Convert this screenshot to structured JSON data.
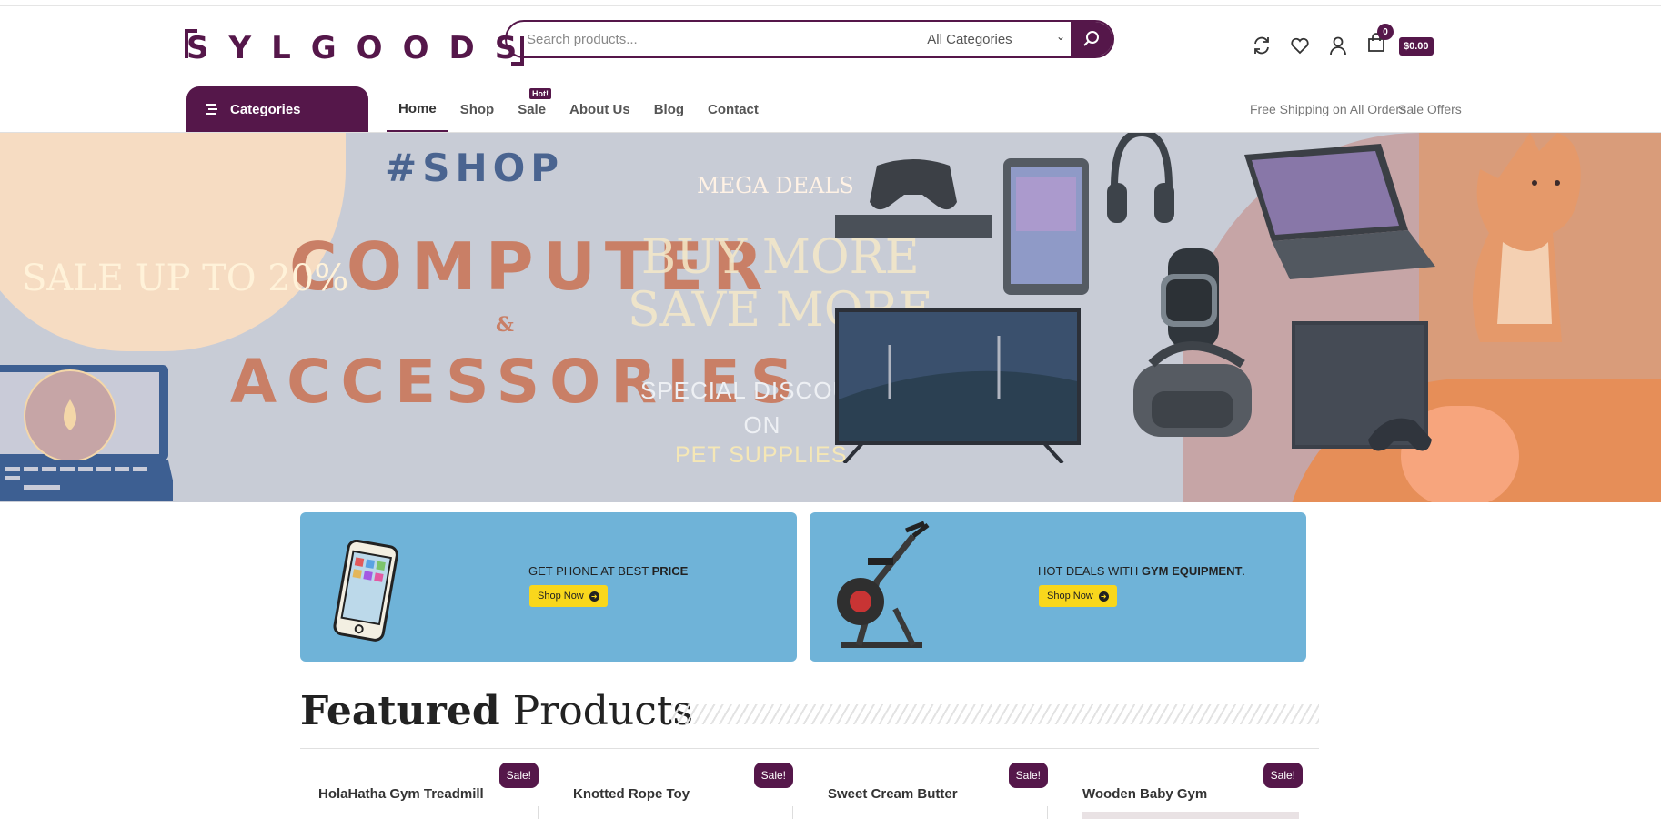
{
  "brand": {
    "logo_text": "SYLGOODS"
  },
  "search": {
    "placeholder": "Search products...",
    "category": "All Categories"
  },
  "header": {
    "cart_count": "0",
    "cart_total": "$0.00"
  },
  "nav": {
    "categories_label": "Categories",
    "items": [
      "Home",
      "Shop",
      "Sale",
      "About Us",
      "Blog",
      "Contact"
    ],
    "hot_badge": "Hot!",
    "right_links": [
      "Free Shipping on All Orders",
      "Sale Offers"
    ]
  },
  "hero": {
    "shop_tag": "#SHOP",
    "title_line1": "COMPUTER",
    "ampersand": "&",
    "title_line2": "ACCESSORIES",
    "sale_text": "SALE UP TO 20%",
    "mega": "MEGA DEALS",
    "buy_more": "BUY MORE",
    "save_more": "SAVE MORE",
    "special": "SPECIAL DISCOUNT",
    "on": "ON",
    "pet_supplies": "PET SUPPLIES"
  },
  "promos": [
    {
      "text_plain": "GET PHONE AT BEST ",
      "text_bold": "PRICE",
      "text_after": "",
      "button": "Shop Now"
    },
    {
      "text_plain": "HOT DEALS WITH ",
      "text_bold": "GYM EQUIPMENT",
      "text_after": ".",
      "button": "Shop Now"
    }
  ],
  "featured": {
    "title_bold": "Featured",
    "title_rest": "Products",
    "badge": "Sale!",
    "products": [
      "HolaHatha Gym Treadmill",
      "Knotted Rope Toy",
      "Sweet Cream Butter",
      "Wooden Baby Gym"
    ]
  },
  "colors": {
    "brand": "#55174a",
    "promo_bg": "#6fb3d8",
    "button_yellow": "#f9d71c"
  },
  "icons": [
    "search-icon",
    "compare-icon",
    "heart-icon",
    "user-icon",
    "bag-icon",
    "menu-icon",
    "chevron-down-icon",
    "arrow-right-icon"
  ]
}
